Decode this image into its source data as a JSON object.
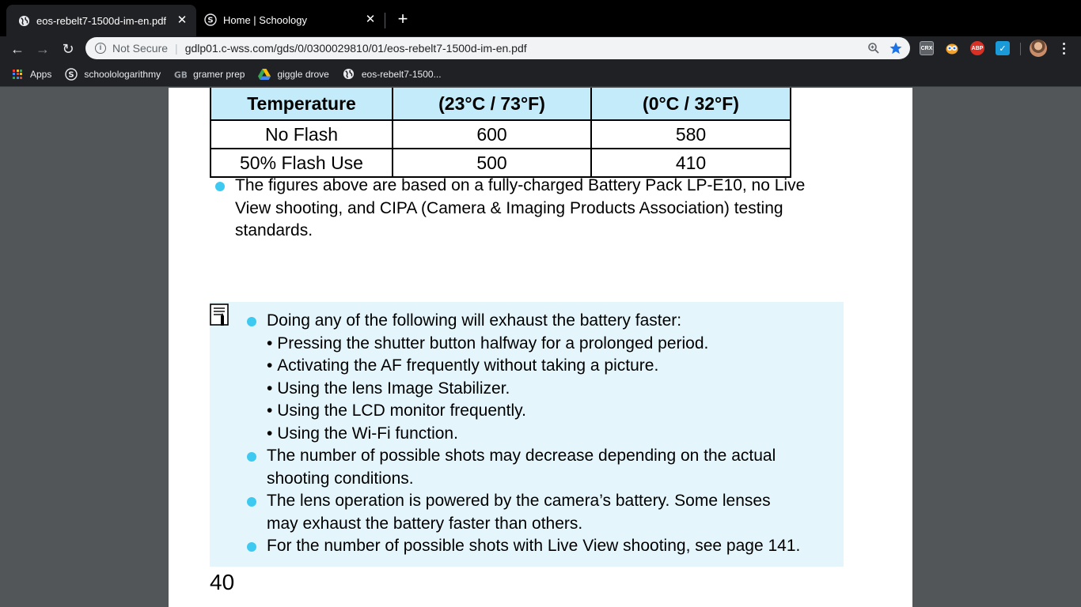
{
  "tabs": [
    {
      "title": "eos-rebelt7-1500d-im-en.pdf",
      "icon": "globe-icon",
      "active": true
    },
    {
      "title": "Home | Schoology",
      "icon": "schoology-icon",
      "active": false
    }
  ],
  "tab_close_glyph": "✕",
  "new_tab_glyph": "+",
  "toolbar": {
    "back_glyph": "←",
    "forward_glyph": "→",
    "reload_glyph": "↻",
    "security_label": "Not Secure",
    "url": "gdlp01.c-wss.com/gds/0/0300029810/01/eos-rebelt7-1500d-im-en.pdf"
  },
  "extensions": [
    {
      "name": "crx-extension-icon",
      "label": "CRX",
      "color": "#5f6368"
    },
    {
      "name": "owl-extension-icon",
      "label": "",
      "color": "#f4a12b"
    },
    {
      "name": "adblock-extension-icon",
      "label": "ABP",
      "color": "#d93025"
    },
    {
      "name": "check-extension-icon",
      "label": "✓",
      "color": "#1a9bd7"
    }
  ],
  "bookmarks": [
    {
      "label": "Apps",
      "icon": "apps-grid-icon"
    },
    {
      "label": "schoolologarithmy",
      "icon": "schoology-icon"
    },
    {
      "label": "gramer prep",
      "icon": "gb-logo-icon"
    },
    {
      "label": "giggle drove",
      "icon": "google-drive-icon"
    },
    {
      "label": "eos-rebelt7-1500...",
      "icon": "globe-icon"
    }
  ],
  "pdf": {
    "table": {
      "header": [
        "Temperature",
        "(23°C / 73°F)",
        "(0°C / 32°F)"
      ],
      "rows": [
        [
          "No Flash",
          "600",
          "580"
        ],
        [
          "50% Flash Use",
          "500",
          "410"
        ]
      ]
    },
    "footnote": [
      "The figures above are based on a fully-charged Battery Pack LP-E10, no Live",
      "View shooting, and CIPA (Camera & Imaging Products Association) testing",
      "standards."
    ],
    "notes": {
      "intro": "Doing any of the following will exhaust the battery faster:",
      "sub_items": [
        "Pressing the shutter button halfway for a prolonged period.",
        "Activating the AF frequently without taking a picture.",
        "Using the lens Image Stabilizer.",
        "Using the LCD monitor frequently.",
        "Using the Wi-Fi function."
      ],
      "sub_bullet": "•",
      "shots_decrease": [
        "The number of possible shots may decrease depending on the actual",
        "shooting conditions."
      ],
      "lens_power": [
        "The lens operation is powered by the camera’s battery. Some lenses",
        "may exhaust the battery faster than others."
      ],
      "live_view": "For the number of possible shots with Live View shooting, see page 141."
    },
    "page_number": "40"
  },
  "colors": {
    "table_header_bg": "#c3ebf9",
    "note_bg": "#e4f6fc",
    "bullet": "#3ec9f0"
  }
}
